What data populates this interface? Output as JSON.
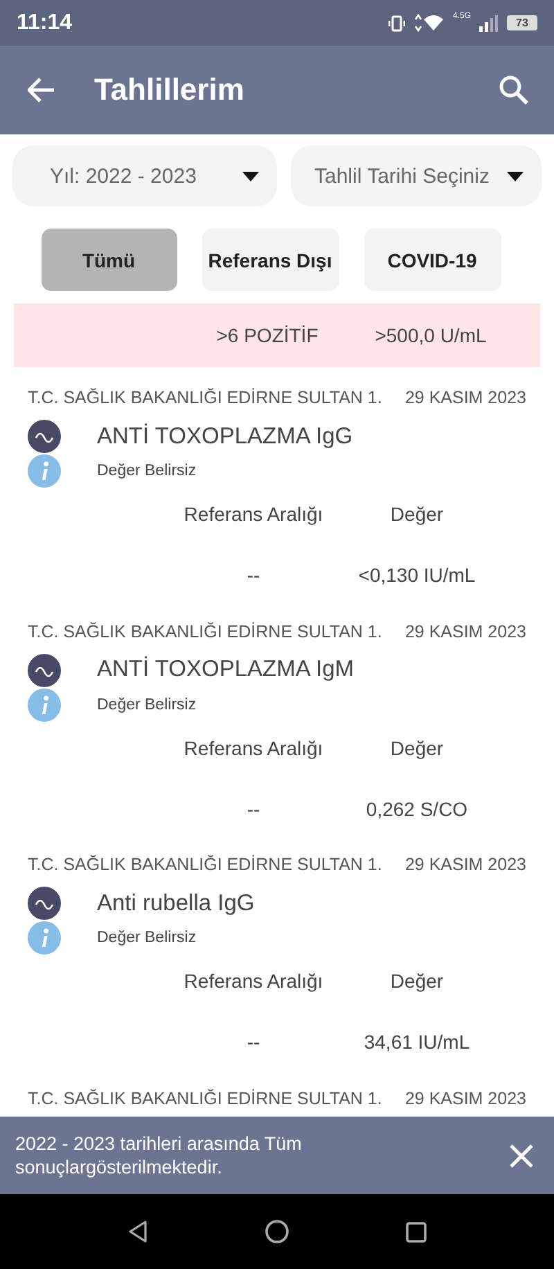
{
  "status_bar": {
    "time": "11:14",
    "network": "4.5G",
    "battery": "73"
  },
  "app_bar": {
    "title": "Tahlillerim"
  },
  "filters": [
    {
      "label": "Yıl: 2022 - 2023"
    },
    {
      "label": "Tahlil Tarihi Seçiniz"
    }
  ],
  "chips": [
    {
      "label": "Tümü",
      "selected": true
    },
    {
      "label": "Referans Dışı",
      "selected": false
    },
    {
      "label": "COVID-19",
      "selected": false
    }
  ],
  "results": [
    {
      "out_of_range": true,
      "reference": ">6 POZİTİF",
      "value": ">500,0 U/mL"
    },
    {
      "out_of_range": false,
      "institution": "T.C. SAĞLIK BAKANLIĞI EDİRNE SULTAN 1.",
      "date": "29 KASIM 2023",
      "test": "ANTİ TOXOPLAZMA IgG",
      "status": "Değer Belirsiz",
      "reference_header": "Referans Aralığı",
      "value_header": "Değer",
      "reference": "--",
      "value": "<0,130 IU/mL"
    },
    {
      "out_of_range": false,
      "institution": "T.C. SAĞLIK BAKANLIĞI EDİRNE SULTAN 1.",
      "date": "29 KASIM 2023",
      "test": "ANTİ TOXOPLAZMA IgM",
      "status": "Değer Belirsiz",
      "reference_header": "Referans Aralığı",
      "value_header": "Değer",
      "reference": "--",
      "value": "0,262 S/CO"
    },
    {
      "out_of_range": false,
      "institution": "T.C. SAĞLIK BAKANLIĞI EDİRNE SULTAN 1.",
      "date": "29 KASIM 2023",
      "test": "Anti rubella IgG",
      "status": "Değer Belirsiz",
      "reference_header": "Referans Aralığı",
      "value_header": "Değer",
      "reference": "--",
      "value": "34,61 IU/mL"
    },
    {
      "out_of_range": false,
      "institution": "T.C. SAĞLIK BAKANLIĞI EDİRNE SULTAN 1.",
      "date": "29 KASIM 2023"
    }
  ],
  "snackbar": {
    "message": "2022 - 2023 tarihleri arasında Tüm sonuçlargösterilmektedir."
  }
}
